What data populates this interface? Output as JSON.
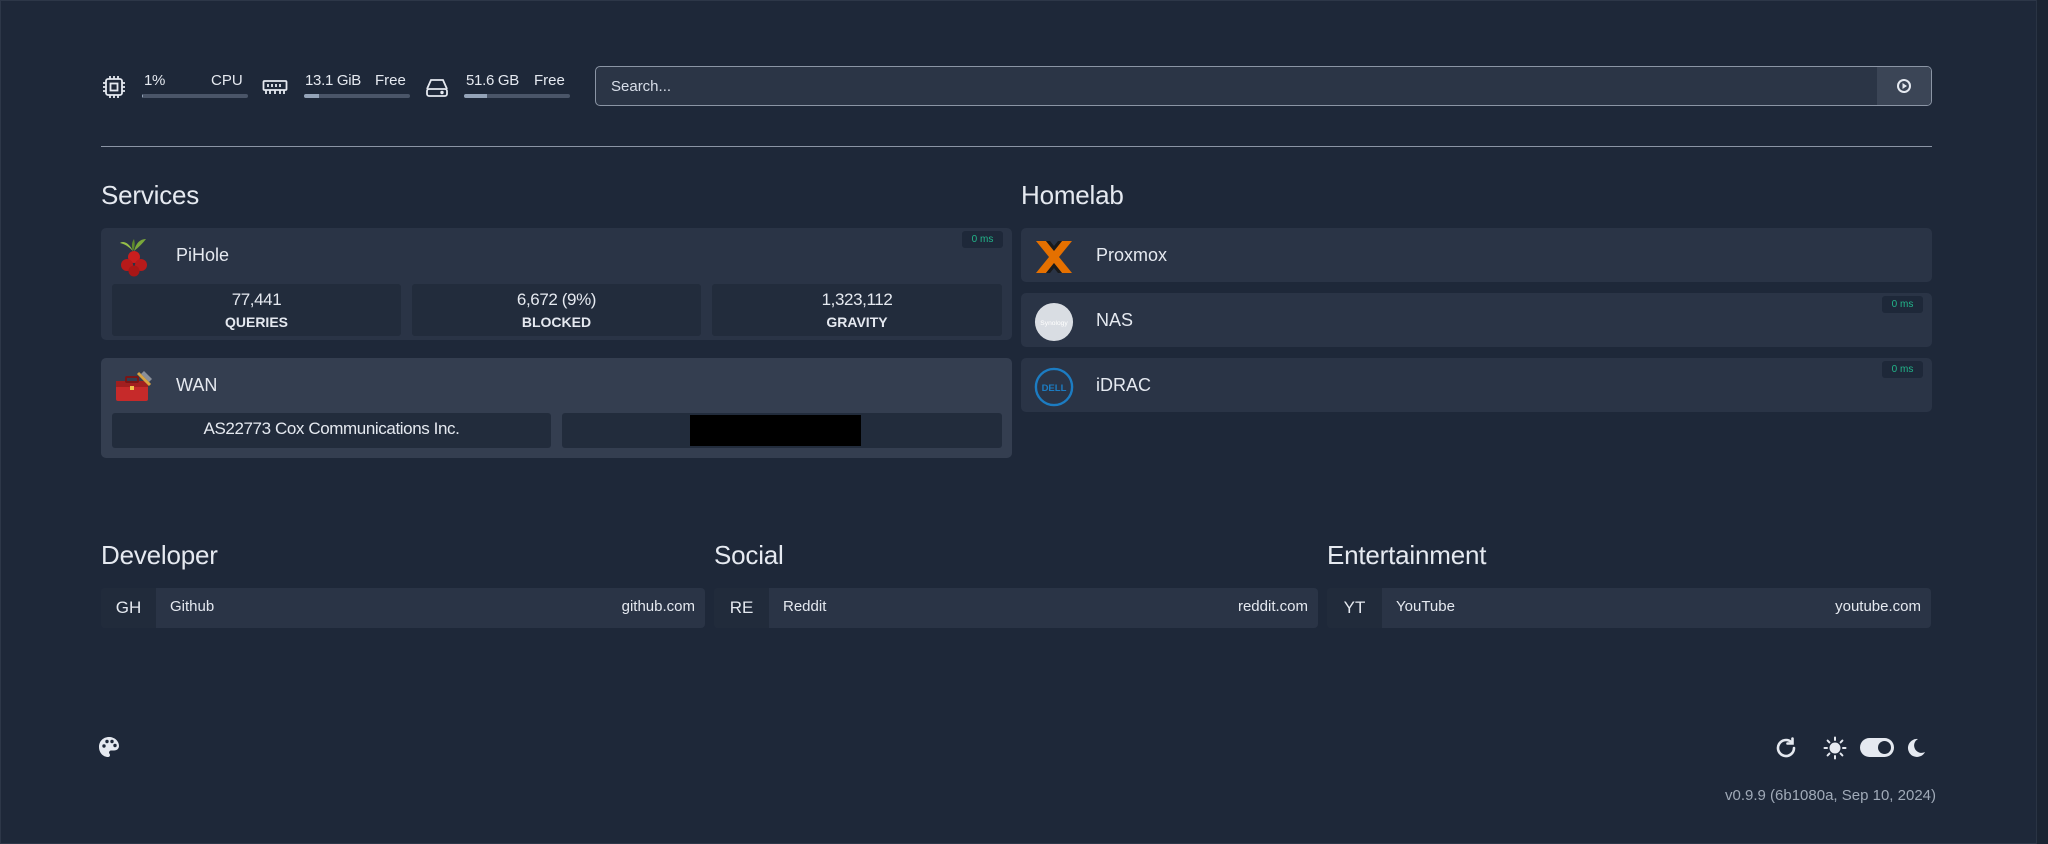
{
  "header": {
    "cpu": {
      "value": "1%",
      "label": "CPU",
      "usage": 0.01,
      "icon": "cpu-icon"
    },
    "memory": {
      "value": "13.1 GiB",
      "label": "Free",
      "usage": 0.14,
      "icon": "memory-icon"
    },
    "disk": {
      "value": "51.6 GB",
      "label": "Free",
      "usage": 0.22,
      "icon": "disk-icon"
    },
    "search": {
      "placeholder": "Search...",
      "icon": "search-engine-icon"
    }
  },
  "groups": {
    "services": {
      "title": "Services",
      "pihole": {
        "name": "PiHole",
        "ping": "0 ms",
        "icon": "pihole-icon",
        "stats": [
          {
            "value": "77,441",
            "label": "Queries"
          },
          {
            "value": "6,672 (9%)",
            "label": "Blocked"
          },
          {
            "value": "1,323,112",
            "label": "Gravity"
          }
        ]
      },
      "wan": {
        "name": "WAN",
        "icon": "wan-toolbox-icon",
        "isp": "AS22773 Cox Communications Inc.",
        "ip_redacted": true
      }
    },
    "homelab": {
      "title": "Homelab",
      "items": [
        {
          "name": "Proxmox",
          "icon": "proxmox-icon"
        },
        {
          "name": "NAS",
          "icon": "synology-icon",
          "ping": "0 ms",
          "logo_text": "Synology"
        },
        {
          "name": "iDRAC",
          "icon": "dell-icon",
          "ping": "0 ms",
          "logo_text": "DELL"
        }
      ]
    }
  },
  "bookmarks": [
    {
      "title": "Developer",
      "items": [
        {
          "abbr": "GH",
          "name": "Github",
          "url": "github.com"
        }
      ]
    },
    {
      "title": "Social",
      "items": [
        {
          "abbr": "RE",
          "name": "Reddit",
          "url": "reddit.com"
        }
      ]
    },
    {
      "title": "Entertainment",
      "items": [
        {
          "abbr": "YT",
          "name": "YouTube",
          "url": "youtube.com"
        }
      ]
    }
  ],
  "footer": {
    "version": "v0.9.9 (6b1080a, Sep 10, 2024)",
    "theme_icon": "palette-icon",
    "refresh_icon": "refresh-icon",
    "light_icon": "sun-icon",
    "dark_icon": "moon-icon",
    "theme_toggle_on": true
  },
  "colors": {
    "background": "#1e2839",
    "card": "#2a3446",
    "ping_text": "#22b58a",
    "dell_blue": "#1c7cc2",
    "proxmox_orange": "#e57000"
  }
}
